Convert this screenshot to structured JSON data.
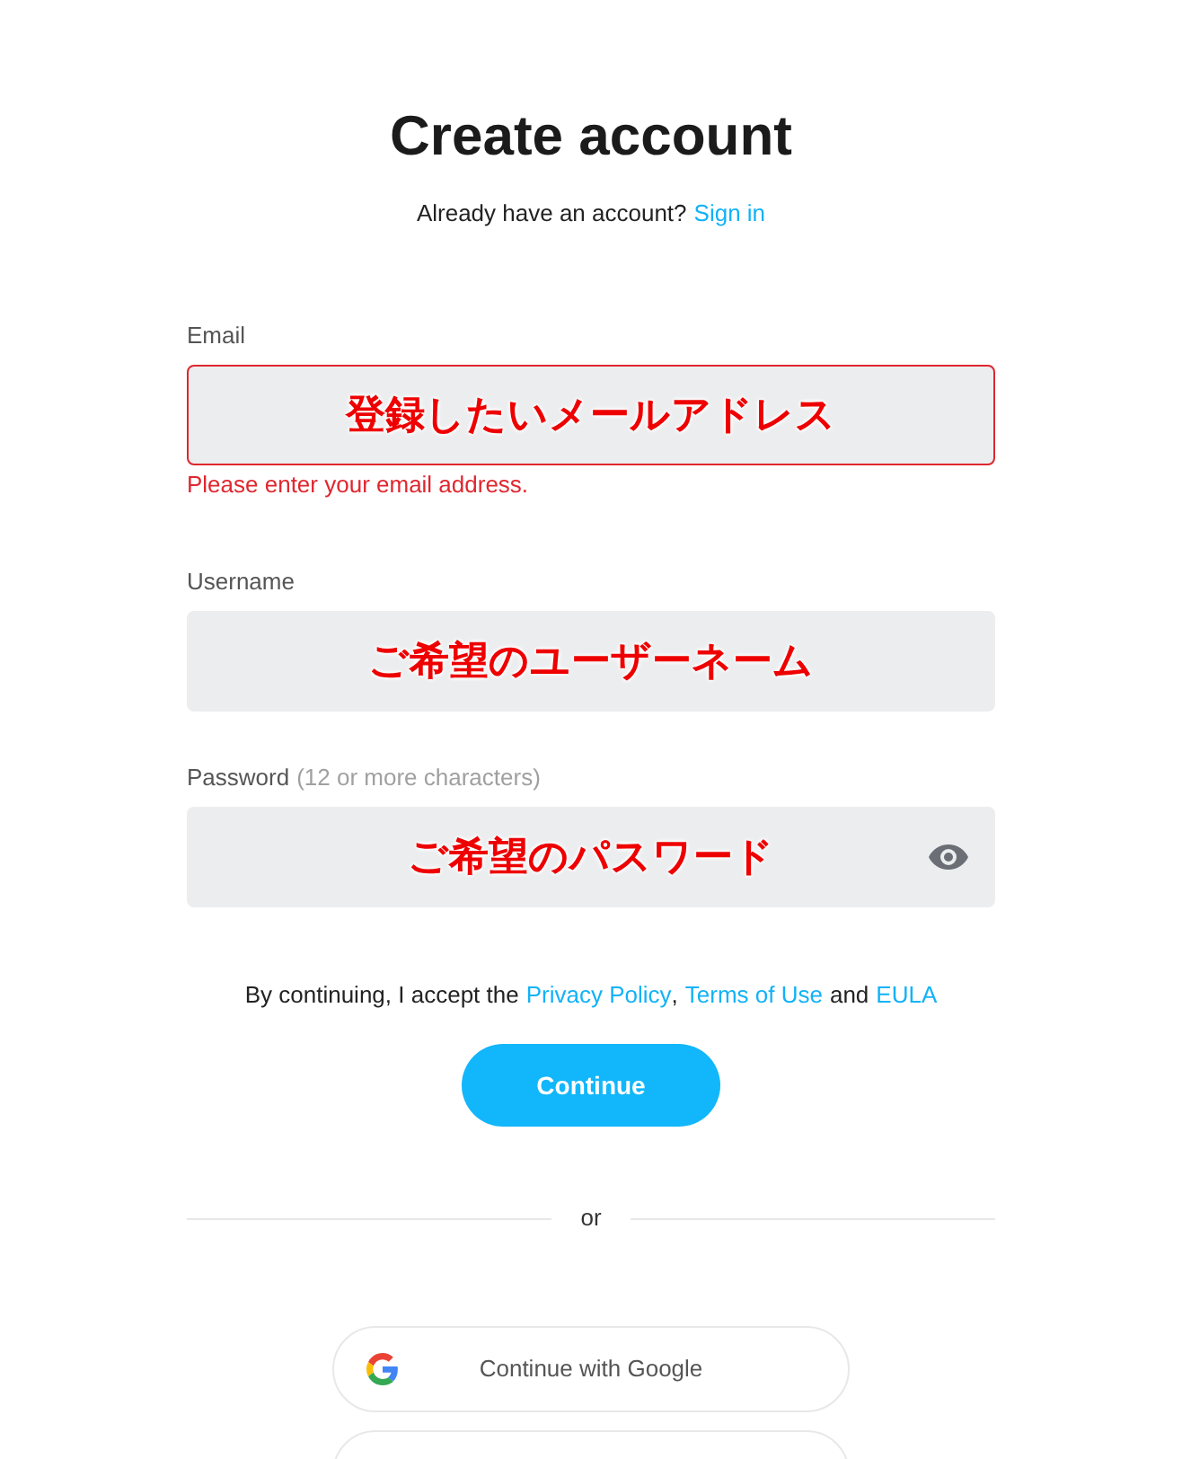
{
  "title": "Create account",
  "signin": {
    "prompt": "Already have an account?",
    "link": "Sign in"
  },
  "fields": [
    {
      "kind": "text",
      "label": "Email",
      "annotation": "登録したいメールアドレス",
      "error": true,
      "error_text": "Please enter your email address."
    },
    {
      "kind": "text",
      "label": "Username",
      "annotation": "ご希望のユーザーネーム",
      "error": false
    },
    {
      "kind": "password",
      "label": "Password",
      "hint": "(12 or more characters)",
      "annotation": "ご希望のパスワード",
      "error": false
    }
  ],
  "terms": {
    "text": "By continuing, I accept the",
    "link1": "Privacy Policy",
    "sep": ",",
    "link2": "Terms of Use",
    "and": "and",
    "link3": "EULA"
  },
  "continue_button": "Continue",
  "divider": "or",
  "social_buttons": [
    {
      "label": "Continue with Google",
      "kind": "google"
    }
  ]
}
